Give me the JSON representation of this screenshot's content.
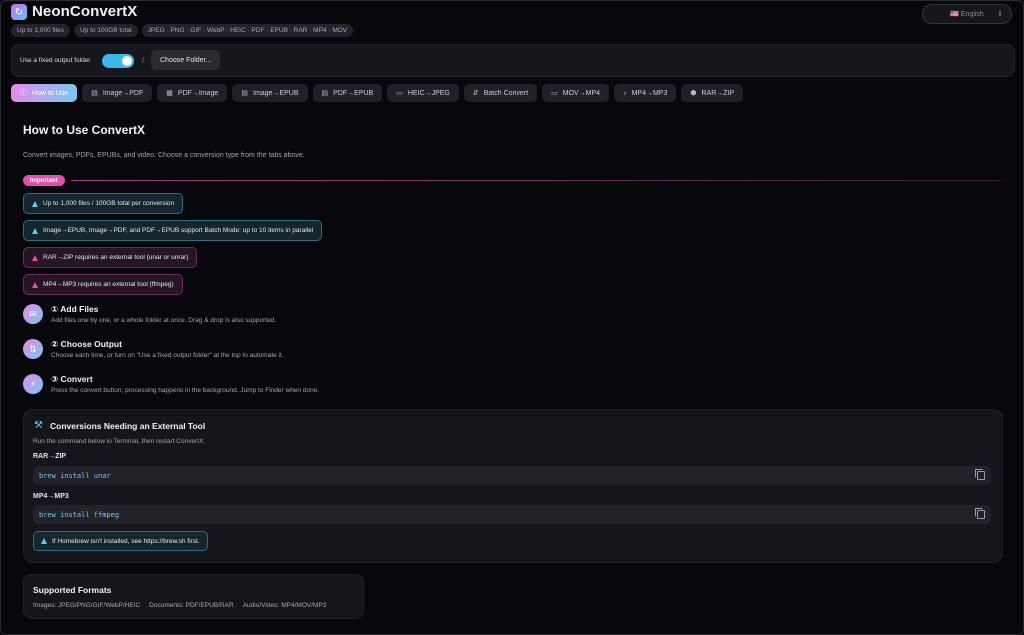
{
  "app": {
    "title": "NeonConvertX",
    "logo_icon": "refresh-icon",
    "pills": [
      "Up to 1,000 files",
      "Up to 100GB total",
      "JPEG · PNG · GIF · WebP · HEIC · PDF · EPUB · RAR · MP4 · MOV"
    ],
    "language": "🇺🇸 English",
    "language_chevron": "⇕"
  },
  "folder_bar": {
    "label": "Use a fixed output folder",
    "toggle_on": true,
    "separator": "/",
    "choose_button": "Choose Folder..."
  },
  "tabs": [
    {
      "icon": "ⓘ",
      "label": "How to Use",
      "active": true
    },
    {
      "icon": "▤",
      "label": "Image→PDF"
    },
    {
      "icon": "▦",
      "label": "PDF→Image"
    },
    {
      "icon": "▤",
      "label": "Image→EPUB"
    },
    {
      "icon": "▤",
      "label": "PDF→EPUB"
    },
    {
      "icon": "▭",
      "label": "HEIC→JPEG"
    },
    {
      "icon": "⇵",
      "label": "Batch Convert"
    },
    {
      "icon": "▭",
      "label": "MOV→MP4"
    },
    {
      "icon": "♪",
      "label": "MP4→MP3"
    },
    {
      "icon": "⬢",
      "label": "RAR→ZIP"
    }
  ],
  "main": {
    "title": "How to Use ConvertX",
    "intro": "Convert images, PDFs, EPUBs, and video. Choose a conversion type from the tabs above.",
    "important_label": "Important",
    "notes": [
      {
        "text": "Up to 1,000 files / 100GB total per conversion",
        "tone": "blue"
      },
      {
        "text": "Image→EPUB, Image→PDF, and PDF→EPUB support Batch Mode: up to 10 items in parallel",
        "tone": "blue"
      },
      {
        "text": "RAR→ZIP requires an external tool (unar or unrar)",
        "tone": "pink"
      },
      {
        "text": "MP4→MP3 requires an external tool (ffmpeg)",
        "tone": "pink"
      }
    ],
    "steps": [
      {
        "icon": "✉",
        "title": "① Add Files",
        "desc": "Add files one by one, or a whole folder at once. Drag & drop is also supported."
      },
      {
        "icon": "⇅",
        "title": "② Choose Output",
        "desc": "Choose each time, or turn on \"Use a fixed output folder\" at the top to automate it."
      },
      {
        "icon": "⚡",
        "title": "③ Convert",
        "desc": "Press the convert button; processing happens in the background. Jump to Finder when done."
      }
    ]
  },
  "external": {
    "icon": "⚒",
    "title": "Conversions Needing an External Tool",
    "subtitle": "Run the command below in Terminal, then restart ConvertX.",
    "commands": [
      {
        "label": "RAR→ZIP",
        "command": "brew install unar"
      },
      {
        "label": "MP4→MP3",
        "command": "brew install ffmpeg"
      }
    ],
    "note": "If Homebrew isn't installed, see https://brew.sh first."
  },
  "formats": {
    "title": "Supported Formats",
    "items": [
      "Images: JPEG/PNG/GIF/WebP/HEIC",
      "Documents: PDF/EPUB/RAR",
      "Audio/Video: MP4/MOV/MP3"
    ]
  },
  "colors": {
    "accent_pink": "#e58be8",
    "accent_blue": "#79c7f1",
    "important": "#e04fa9",
    "background": "#08080c"
  }
}
